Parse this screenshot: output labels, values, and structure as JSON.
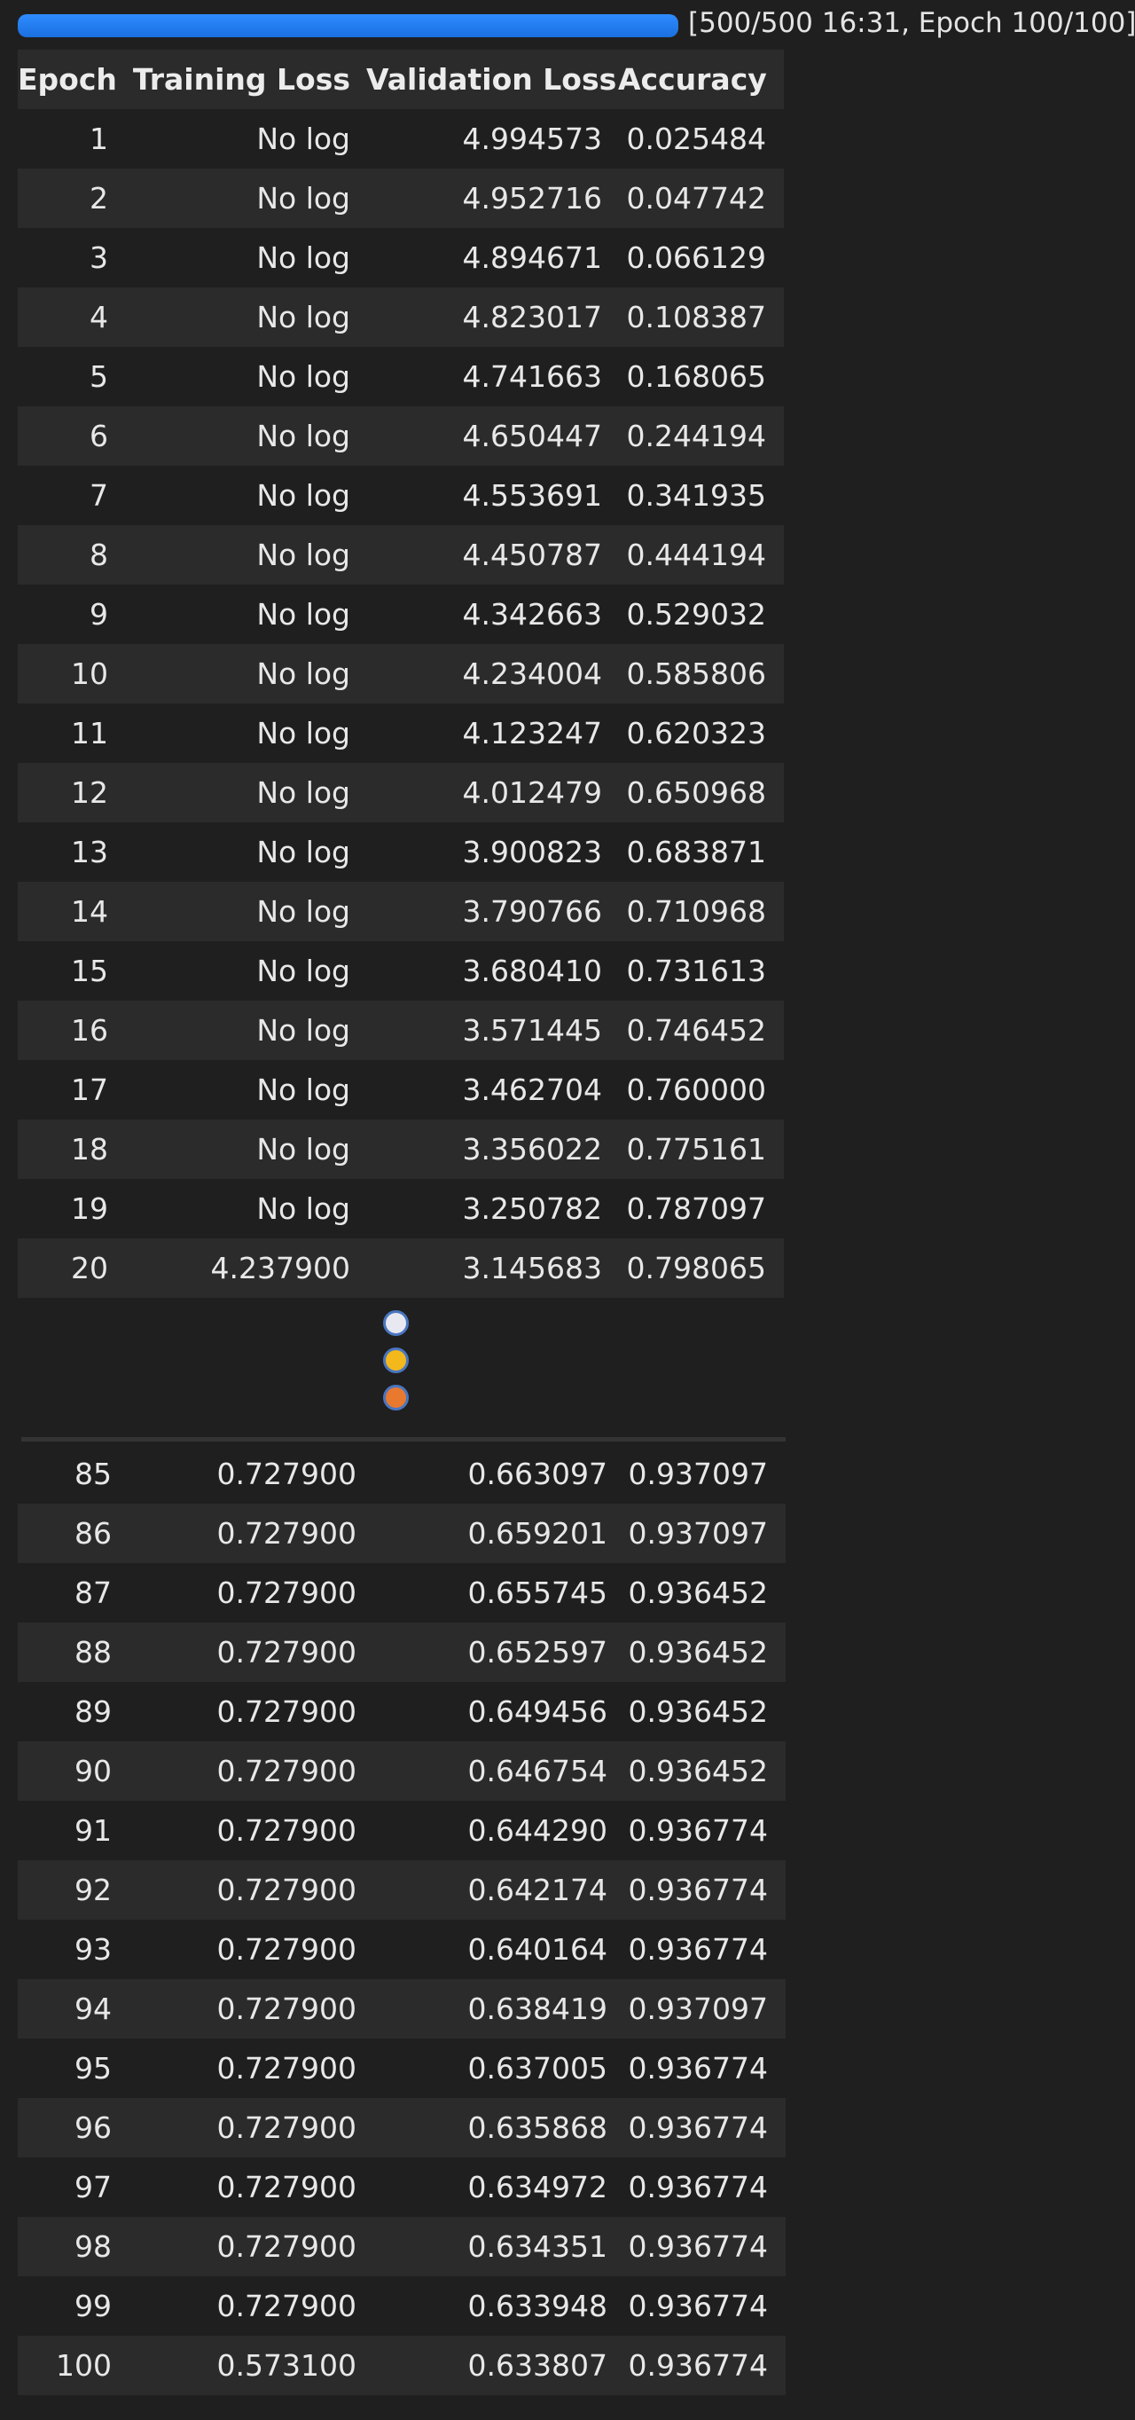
{
  "progress": {
    "text": "[500/500 16:31, Epoch 100/100]",
    "fraction": 1.0,
    "color": "#1a73e8"
  },
  "table": {
    "headers": [
      "Epoch",
      "Training Loss",
      "Validation Loss",
      "Accuracy"
    ],
    "rows_top": [
      [
        "1",
        "No log",
        "4.994573",
        "0.025484"
      ],
      [
        "2",
        "No log",
        "4.952716",
        "0.047742"
      ],
      [
        "3",
        "No log",
        "4.894671",
        "0.066129"
      ],
      [
        "4",
        "No log",
        "4.823017",
        "0.108387"
      ],
      [
        "5",
        "No log",
        "4.741663",
        "0.168065"
      ],
      [
        "6",
        "No log",
        "4.650447",
        "0.244194"
      ],
      [
        "7",
        "No log",
        "4.553691",
        "0.341935"
      ],
      [
        "8",
        "No log",
        "4.450787",
        "0.444194"
      ],
      [
        "9",
        "No log",
        "4.342663",
        "0.529032"
      ],
      [
        "10",
        "No log",
        "4.234004",
        "0.585806"
      ],
      [
        "11",
        "No log",
        "4.123247",
        "0.620323"
      ],
      [
        "12",
        "No log",
        "4.012479",
        "0.650968"
      ],
      [
        "13",
        "No log",
        "3.900823",
        "0.683871"
      ],
      [
        "14",
        "No log",
        "3.790766",
        "0.710968"
      ],
      [
        "15",
        "No log",
        "3.680410",
        "0.731613"
      ],
      [
        "16",
        "No log",
        "3.571445",
        "0.746452"
      ],
      [
        "17",
        "No log",
        "3.462704",
        "0.760000"
      ],
      [
        "18",
        "No log",
        "3.356022",
        "0.775161"
      ],
      [
        "19",
        "No log",
        "3.250782",
        "0.787097"
      ],
      [
        "20",
        "4.237900",
        "3.145683",
        "0.798065"
      ]
    ],
    "rows_bottom": [
      [
        "85",
        "0.727900",
        "0.663097",
        "0.937097"
      ],
      [
        "86",
        "0.727900",
        "0.659201",
        "0.937097"
      ],
      [
        "87",
        "0.727900",
        "0.655745",
        "0.936452"
      ],
      [
        "88",
        "0.727900",
        "0.652597",
        "0.936452"
      ],
      [
        "89",
        "0.727900",
        "0.649456",
        "0.936452"
      ],
      [
        "90",
        "0.727900",
        "0.646754",
        "0.936452"
      ],
      [
        "91",
        "0.727900",
        "0.644290",
        "0.936774"
      ],
      [
        "92",
        "0.727900",
        "0.642174",
        "0.936774"
      ],
      [
        "93",
        "0.727900",
        "0.640164",
        "0.936774"
      ],
      [
        "94",
        "0.727900",
        "0.638419",
        "0.937097"
      ],
      [
        "95",
        "0.727900",
        "0.637005",
        "0.936774"
      ],
      [
        "96",
        "0.727900",
        "0.635868",
        "0.936774"
      ],
      [
        "97",
        "0.727900",
        "0.634972",
        "0.936774"
      ],
      [
        "98",
        "0.727900",
        "0.634351",
        "0.936774"
      ],
      [
        "99",
        "0.727900",
        "0.633948",
        "0.936774"
      ],
      [
        "100",
        "0.573100",
        "0.633807",
        "0.936774"
      ]
    ]
  },
  "omission_marker": {
    "dot_colors": [
      "#e8e8f0",
      "#f3b81c",
      "#e8792f"
    ]
  }
}
